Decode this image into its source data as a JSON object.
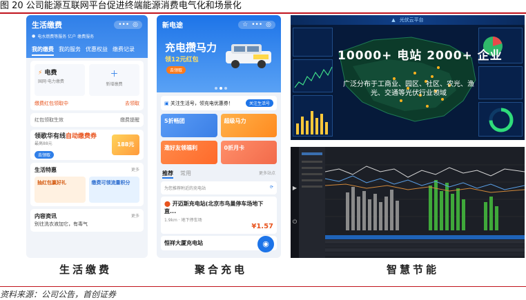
{
  "figure": {
    "title": "图 20 公司能源互联网平台促进终端能源消费电气化和场景化",
    "source": "资料来源：公司公告，首创证券"
  },
  "captions": {
    "left": "生活缴费",
    "middle": "聚合充电",
    "right": "智慧节能"
  },
  "phone1": {
    "title": "生活缴费",
    "account_note": "电水燃费等服务 亿户 缴费服务",
    "tabs": [
      "我的缴费",
      "我的服务",
      "优惠权益",
      "缴费记录"
    ],
    "bills": [
      {
        "label": "电费",
        "sub": "国网·电力缴费"
      },
      {
        "label": "新增缴费",
        "sub": ""
      }
    ],
    "redpacket": "缴费红包领取中",
    "redpacket_link": "去领取",
    "coupon_note": "红包领取生效",
    "coupon_link": "缴费提醒",
    "promo_text": "领歌华有线",
    "promo_highlight": "自动缴费券",
    "promo_sub": "最高88元",
    "promo_button": "去领取",
    "gift_label": "188元",
    "special_title": "生活特惠",
    "special_more": "更多",
    "special_a": "抽红包赢好礼",
    "special_b": "缴费可领流量积分",
    "news_title": "内容资讯",
    "news_more": "更多",
    "news_text": "别往洗衣液加它，有毒气"
  },
  "phone2": {
    "title": "新电途",
    "slogan": "充电攒马力",
    "slogan_sub": "领12元红包",
    "slogan_btn": "去领取",
    "follow_text": "关注生活号，领充电优惠券！",
    "follow_btn": "关注生活号",
    "tiles": [
      "5折畅团",
      "超级马力",
      "邀好友领福利",
      "0折月卡"
    ],
    "rec_tabs": [
      "推荐",
      "常用"
    ],
    "rec_more": "更多站点",
    "nearby_note": "为您推荐附近的充电站",
    "station_name": "开迈斯充电站(北京市鸟巢停车场地下直...",
    "station_meta": "1.9km · 地下停车场",
    "station_price": "¥1.57",
    "station2": "恒祥大厦充电站"
  },
  "dashboard1": {
    "header": "光伏云平台",
    "headline": "10000+ 电站 2000+ 企业",
    "message": "广泛分布于工商业、园区、社区、农光、渔光、交通等光伏行业领域"
  },
  "dashboard2": {
    "label": "智慧节能"
  },
  "colors": {
    "accent_red": "#c0121c",
    "phone_blue": "#2f7fe8",
    "dash_navy": "#061a3a",
    "dash_dark": "#1c1f26",
    "green_bars": "#3fa83a"
  }
}
